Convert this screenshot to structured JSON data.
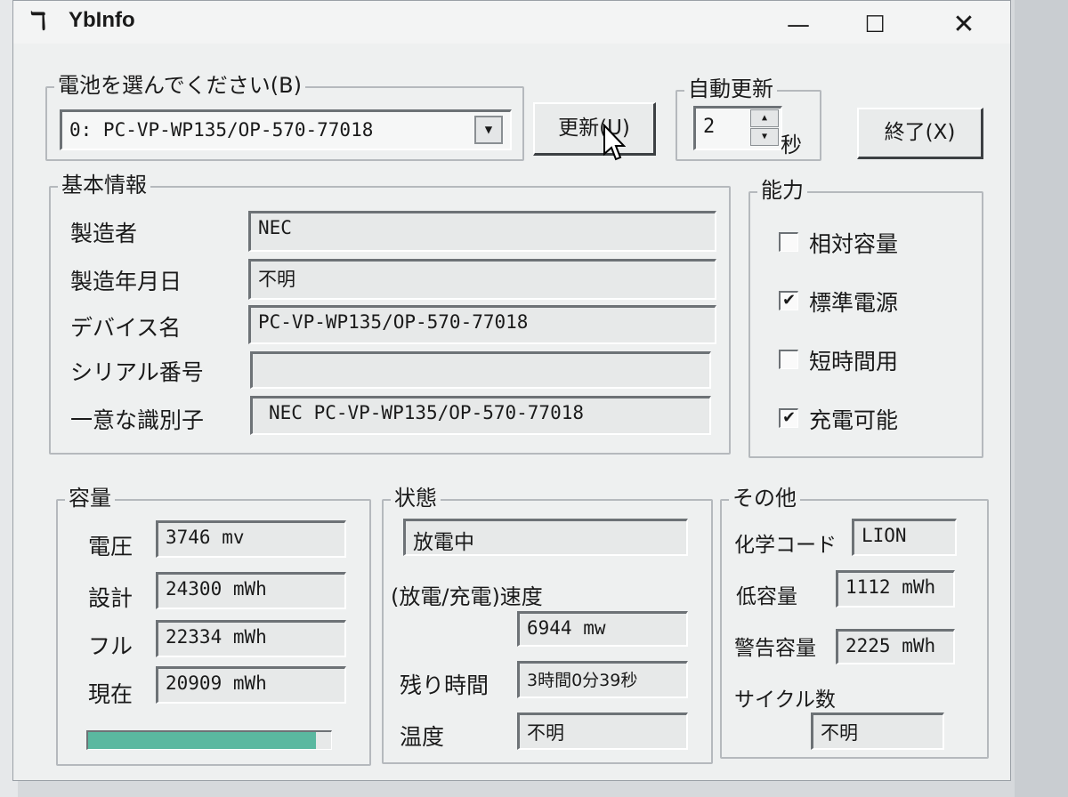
{
  "window": {
    "title": "YbInfo",
    "icon": "yb-app-icon",
    "minimize": "—",
    "maximize": "☐",
    "close": "✕"
  },
  "battery_select": {
    "group_label": "電池を選んでください(B)",
    "value": "0: PC-VP-WP135/OP-570-77018"
  },
  "buttons": {
    "refresh": "更新(U)",
    "exit": "終了(X)"
  },
  "auto_update": {
    "group_label": "自動更新",
    "value": "2",
    "unit": "秒"
  },
  "basic_info": {
    "group_label": "基本情報",
    "rows": [
      {
        "label": "製造者",
        "value": "NEC"
      },
      {
        "label": "製造年月日",
        "value": "不明"
      },
      {
        "label": "デバイス名",
        "value": "PC-VP-WP135/OP-570-77018"
      },
      {
        "label": "シリアル番号",
        "value": ""
      },
      {
        "label": "一意な識別子",
        "value": "NEC  PC-VP-WP135/OP-570-77018"
      }
    ]
  },
  "capability": {
    "group_label": "能力",
    "items": [
      {
        "label": "相対容量",
        "checked": false
      },
      {
        "label": "標準電源",
        "checked": true
      },
      {
        "label": "短時間用",
        "checked": false
      },
      {
        "label": "充電可能",
        "checked": true
      }
    ]
  },
  "capacity": {
    "group_label": "容量",
    "rows": [
      {
        "label": "電圧",
        "value": "3746 mv"
      },
      {
        "label": "設計",
        "value": "24300 mWh"
      },
      {
        "label": "フル",
        "value": "22334 mWh"
      },
      {
        "label": "現在",
        "value": "20909 mWh"
      }
    ],
    "charge_fraction": 0.936,
    "bar_color": "#5ab8a0"
  },
  "status": {
    "group_label": "状態",
    "state_value": "放電中",
    "rate_label": "(放電/充電)速度",
    "rate_value": "6944 mw",
    "remaining_label": "残り時間",
    "remaining_value": "3時間0分39秒",
    "temp_label": "温度",
    "temp_value": "不明"
  },
  "other": {
    "group_label": "その他",
    "chem_label": "化学コード",
    "chem_value": "LION",
    "low_label": "低容量",
    "low_value": "1112 mWh",
    "warn_label": "警告容量",
    "warn_value": "2225 mWh",
    "cycle_label": "サイクル数",
    "cycle_value": "不明"
  }
}
